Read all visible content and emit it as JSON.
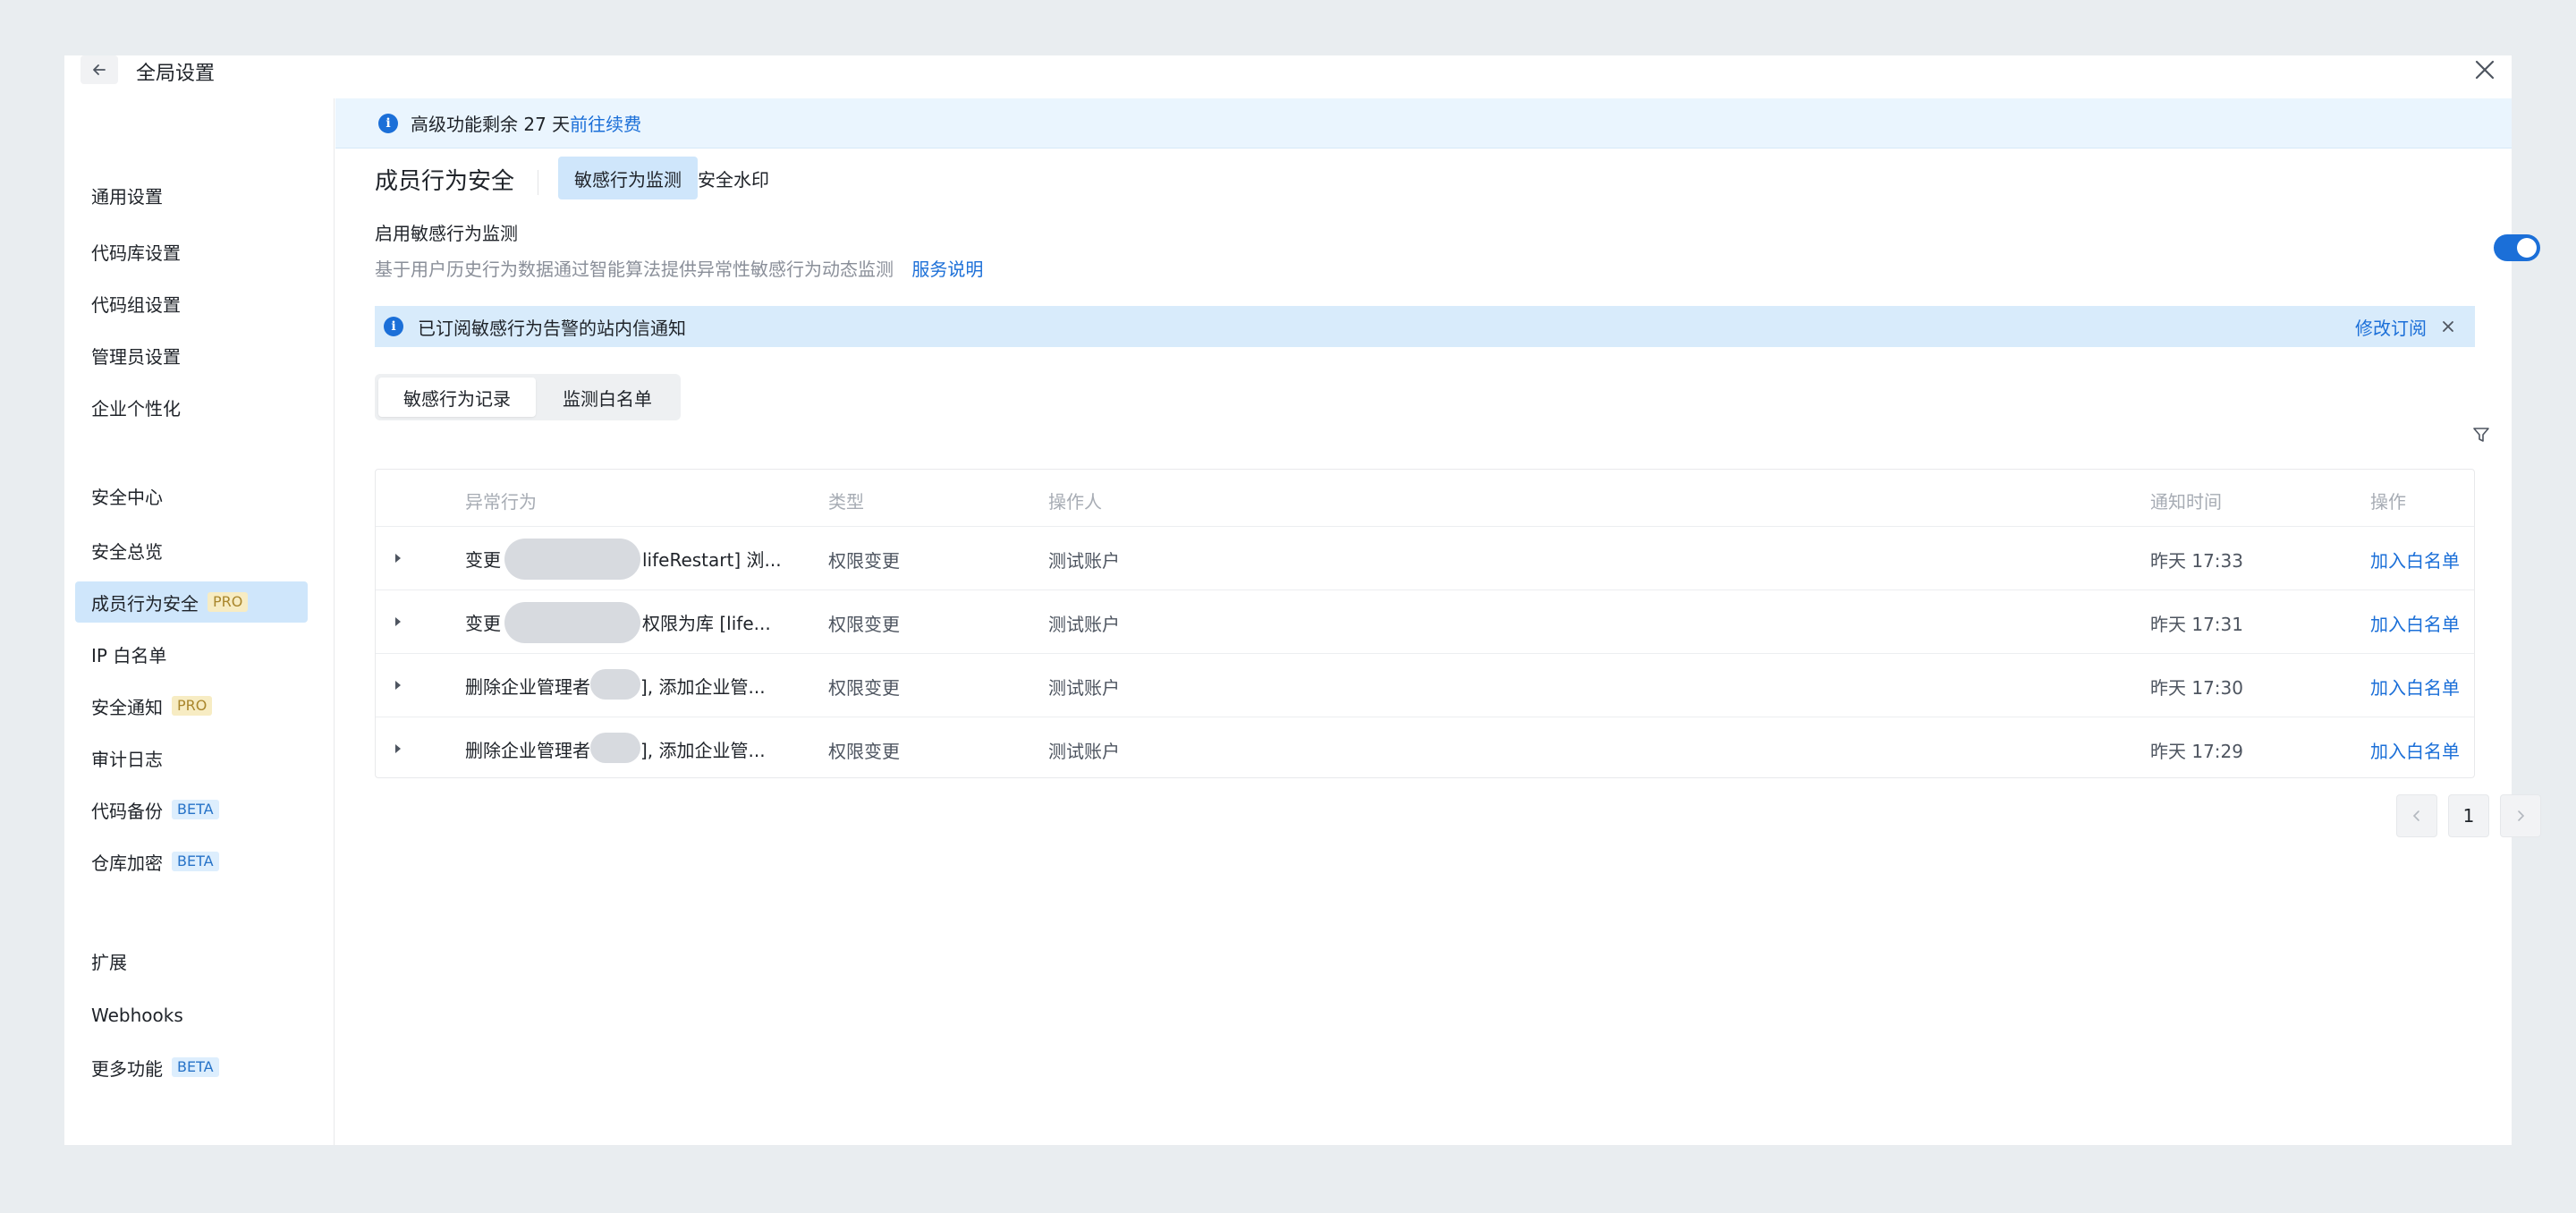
{
  "header": {
    "title": "全局设置"
  },
  "sidebar": {
    "groups": [
      {
        "title": "通用设置",
        "items": [
          {
            "label": "代码库设置"
          },
          {
            "label": "代码组设置"
          },
          {
            "label": "管理员设置"
          },
          {
            "label": "企业个性化"
          }
        ]
      },
      {
        "title": "安全中心",
        "items": [
          {
            "label": "安全总览"
          },
          {
            "label": "成员行为安全",
            "tag": "PRO",
            "active": true
          },
          {
            "label": "IP 白名单"
          },
          {
            "label": "安全通知",
            "tag": "PRO"
          },
          {
            "label": "审计日志"
          },
          {
            "label": "代码备份",
            "tag": "BETA"
          },
          {
            "label": "仓库加密",
            "tag": "BETA"
          }
        ]
      },
      {
        "title": "扩展",
        "items": [
          {
            "label": "Webhooks"
          },
          {
            "label": "更多功能",
            "tag": "BETA"
          }
        ]
      }
    ]
  },
  "banner": {
    "text": "高级功能剩余 27 天",
    "link": "前往续费"
  },
  "main": {
    "title": "成员行为安全",
    "tabs": [
      {
        "label": "敏感行为监测",
        "active": true
      },
      {
        "label": "安全水印"
      }
    ],
    "enable_label": "启用敏感行为监测",
    "enable_desc": "基于用户历史行为数据通过智能算法提供异常性敏感行为动态监测",
    "service_link": "服务说明",
    "enabled": true
  },
  "notice": {
    "text": "已订阅敏感行为告警的站内信通知",
    "action": "修改订阅"
  },
  "sub_tabs": [
    {
      "label": "敏感行为记录",
      "active": true
    },
    {
      "label": "监测白名单"
    }
  ],
  "table": {
    "columns": [
      "异常行为",
      "类型",
      "操作人",
      "通知时间",
      "操作"
    ],
    "rows": [
      {
        "prefix": "变更",
        "suffix": "lifeRestart] 浏...",
        "type": "权限变更",
        "operator": "测试账户",
        "time": "昨天 17:33",
        "action": "加入白名单"
      },
      {
        "prefix": "变更",
        "suffix": "权限为库 [life...",
        "type": "权限变更",
        "operator": "测试账户",
        "time": "昨天 17:31",
        "action": "加入白名单"
      },
      {
        "prefix": "删除企业管理者",
        "suffix": "], 添加企业管...",
        "type": "权限变更",
        "operator": "测试账户",
        "time": "昨天 17:30",
        "action": "加入白名单"
      },
      {
        "prefix": "删除企业管理者",
        "suffix": "], 添加企业管...",
        "type": "权限变更",
        "operator": "测试账户",
        "time": "昨天 17:29",
        "action": "加入白名单"
      }
    ]
  },
  "pagination": {
    "current": "1"
  }
}
